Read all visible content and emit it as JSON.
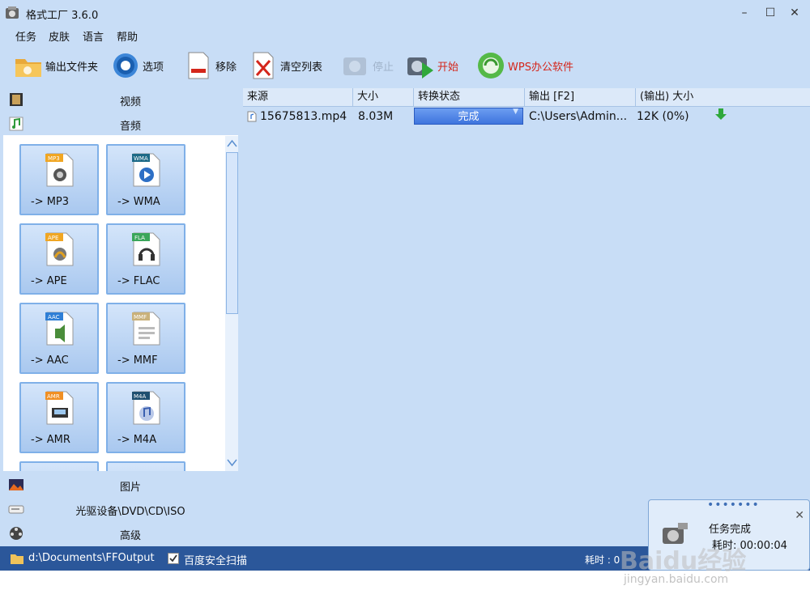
{
  "window": {
    "title": "格式工厂 3.6.0",
    "minimize": "–",
    "maximize": "☐",
    "close": "✕"
  },
  "menu": [
    "任务",
    "皮肤",
    "语言",
    "帮助"
  ],
  "toolbar": {
    "output_folder": "输出文件夹",
    "options": "选项",
    "remove": "移除",
    "clear_list": "清空列表",
    "stop": "停止",
    "start": "开始",
    "wps": "WPS办公软件"
  },
  "sidebar": {
    "video": "视频",
    "audio": "音频",
    "picture": "图片",
    "optical": "光驱设备\\DVD\\CD\\ISO",
    "advanced": "高级"
  },
  "formats": [
    {
      "badge": "MP3",
      "label": "-> MP3"
    },
    {
      "badge": "WMA",
      "label": "-> WMA"
    },
    {
      "badge": "APE",
      "label": "-> APE"
    },
    {
      "badge": "FLA",
      "label": "-> FLAC"
    },
    {
      "badge": "AAC",
      "label": "-> AAC"
    },
    {
      "badge": "MMF",
      "label": "-> MMF"
    },
    {
      "badge": "AMR",
      "label": "-> AMR"
    },
    {
      "badge": "M4A",
      "label": "-> M4A"
    }
  ],
  "table": {
    "headers": [
      "来源",
      "大小",
      "转换状态",
      "输出 [F2]",
      "(输出) 大小"
    ],
    "rows": [
      {
        "source": "15675813.mp4",
        "size": "8.03M",
        "status": "完成",
        "output": "C:\\Users\\Admin...",
        "out_size": "12K  (0%)"
      }
    ]
  },
  "statusbar": {
    "path": "d:\\Documents\\FFOutput",
    "scan": "百度安全扫描",
    "elapsed_label": "耗时 : 0"
  },
  "notification": {
    "title": "任务完成",
    "elapsed": "耗时: 00:00:04"
  },
  "watermark": {
    "text": "Baidu经验",
    "url": "jingyan.baidu.com"
  },
  "colors": {
    "window_bg": "#c8ddf6",
    "statusbar": "#2b579a",
    "status_pill": "#4a7fe6",
    "accent_red": "#d4261b"
  }
}
